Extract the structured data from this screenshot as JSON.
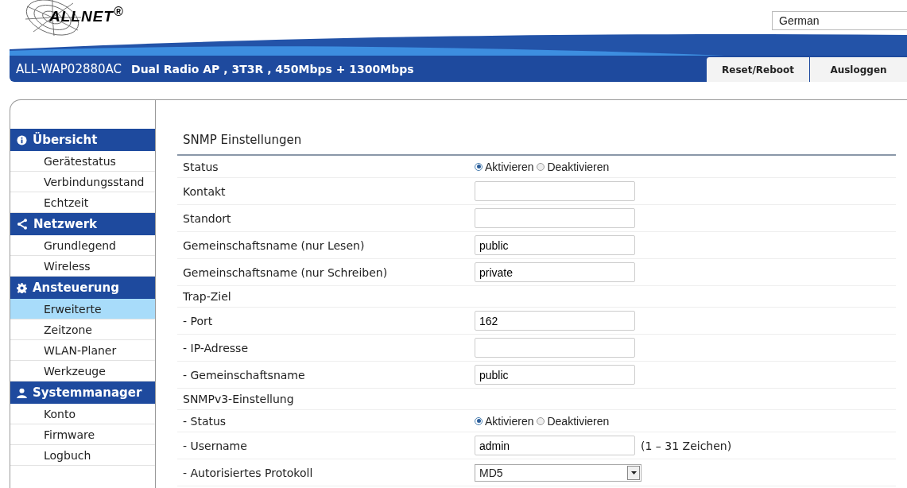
{
  "header": {
    "logo": "ALLNET$^{®}$",
    "language": "German",
    "model": "ALL-WAP02880AC",
    "description": "Dual Radio AP , 3T3R , 450Mbps + 1300Mbps",
    "buttons": [
      "Reset/Reboot",
      "Ausloggen"
    ]
  },
  "sidebar": {
    "groups": [
      {
        "title": "Übersicht",
        "kind": "info",
        "items": [
          {
            "label": "Gerätestatus",
            "selected": false
          },
          {
            "label": "Verbindungsstand",
            "selected": false
          },
          {
            "label": "Echtzeit",
            "selected": false
          }
        ]
      },
      {
        "title": "Netzwerk",
        "kind": "share",
        "items": [
          {
            "label": "Grundlegend",
            "selected": false
          },
          {
            "label": "Wireless",
            "selected": false
          }
        ]
      },
      {
        "title": "Ansteuerung",
        "kind": "gear",
        "items": [
          {
            "label": "Erweiterte",
            "selected": true
          },
          {
            "label": "Zeitzone",
            "selected": false
          },
          {
            "label": "WLAN-Planer",
            "selected": false
          },
          {
            "label": "Werkzeuge",
            "selected": false
          }
        ]
      },
      {
        "title": "Systemmanager",
        "kind": "user",
        "items": [
          {
            "label": "Konto",
            "selected": false
          },
          {
            "label": "Firmware",
            "selected": false
          },
          {
            "label": "Logbuch",
            "selected": false
          }
        ]
      }
    ]
  },
  "form": {
    "title": "SNMP Einstellungen",
    "rows": [
      {
        "kind": "radio",
        "label": "Status",
        "options": [
          {
            "label": "Aktivieren",
            "selected": true
          },
          {
            "label": "Deaktivieren",
            "selected": false
          }
        ]
      },
      {
        "kind": "input",
        "label": "Kontakt",
        "value": ""
      },
      {
        "kind": "input",
        "label": "Standort",
        "value": ""
      },
      {
        "kind": "input",
        "label": "Gemeinschaftsname (nur Lesen)",
        "value": "public"
      },
      {
        "kind": "input",
        "label": "Gemeinschaftsname (nur Schreiben)",
        "value": "private"
      },
      {
        "kind": "section",
        "label": "Trap-Ziel"
      },
      {
        "kind": "input",
        "label": "- Port",
        "value": "162"
      },
      {
        "kind": "input",
        "label": "- IP-Adresse",
        "value": ""
      },
      {
        "kind": "input",
        "label": "- Gemeinschaftsname",
        "value": "public"
      },
      {
        "kind": "section",
        "label": "SNMPv3-Einstellung"
      },
      {
        "kind": "radio",
        "label": "- Status",
        "options": [
          {
            "label": "Aktivieren",
            "selected": true
          },
          {
            "label": "Deaktivieren",
            "selected": false
          }
        ]
      },
      {
        "kind": "input",
        "label": "- Username",
        "value": "admin",
        "hint": "(1 – 31 Zeichen)"
      },
      {
        "kind": "select",
        "label": "- Autorisiertes Protokoll",
        "value": "MD5"
      }
    ]
  }
}
